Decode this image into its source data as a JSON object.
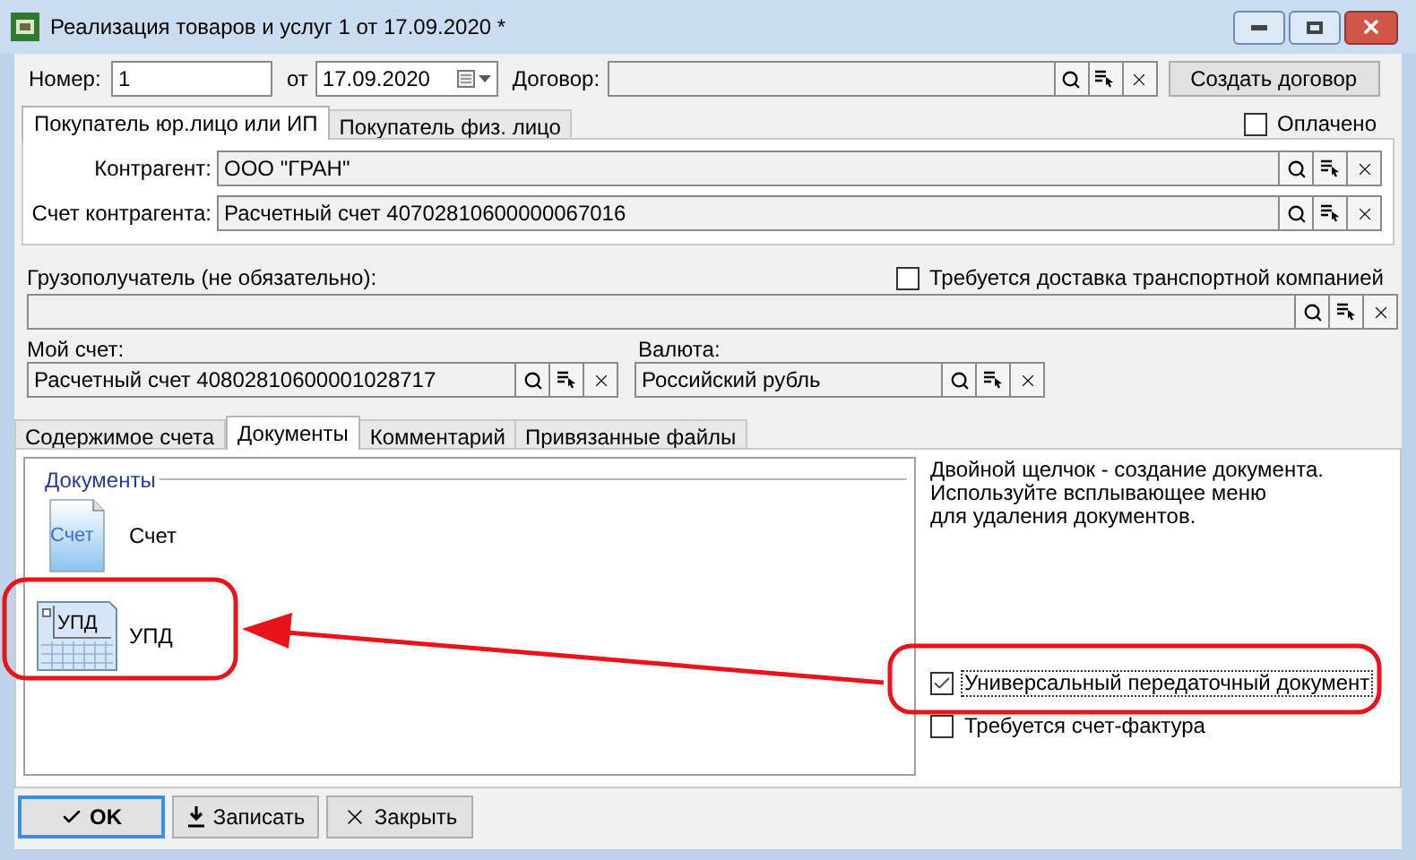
{
  "window": {
    "title": "Реализация товаров и услуг 1 от 17.09.2020 *"
  },
  "header": {
    "number_label": "Номер:",
    "number": "1",
    "date_label": "от",
    "date": "17.09.2020",
    "contract_label": "Договор:",
    "create_contract_button": "Создать договор"
  },
  "buyer_tabs": [
    {
      "label": "Покупатель юр.лицо или ИП",
      "selected": true
    },
    {
      "label": "Покупатель физ. лицо",
      "selected": false
    }
  ],
  "paid": {
    "label": "Оплачено",
    "checked": false
  },
  "buyer_fields": [
    {
      "label": "Контрагент:",
      "value": "ООО \"ГРАН\""
    },
    {
      "label": "Счет контрагента:",
      "value": "Расчетный счет 40702810600000067016"
    }
  ],
  "consignee": {
    "label": "Грузополучатель (не обязательно):"
  },
  "delivery": {
    "label": "Требуется доставка транспортной компанией",
    "checked": false
  },
  "my_account": {
    "label": "Мой счет:",
    "value": "Расчетный счет 40802810600001028717"
  },
  "currency": {
    "label": "Валюта:",
    "value": "Российский рубль"
  },
  "doc_tabs": [
    {
      "label": "Содержимое счета",
      "selected": false
    },
    {
      "label": "Документы",
      "selected": true
    },
    {
      "label": "Комментарий",
      "selected": false
    },
    {
      "label": "Привязанные файлы",
      "selected": false
    }
  ],
  "documents": {
    "group_title": "Документы",
    "items": [
      {
        "kind": "invoice",
        "icon_text": "Счет",
        "label": "Счет"
      },
      {
        "kind": "upd",
        "icon_text": "УПД",
        "label": "УПД"
      }
    ]
  },
  "hint": "Двойной щелчок - создание документа.\nИспользуйте всплывающее меню\nдля удаления документов.",
  "options": [
    {
      "label": "Универсальный передаточный документ",
      "checked": true,
      "focused": true
    },
    {
      "label": "Требуется счет-фактура",
      "checked": false,
      "focused": false
    }
  ],
  "buttons": [
    {
      "kind": "ok",
      "label": "OK",
      "default": true
    },
    {
      "kind": "save",
      "label": "Записать",
      "default": false
    },
    {
      "kind": "close",
      "label": "Закрыть",
      "default": false
    }
  ]
}
